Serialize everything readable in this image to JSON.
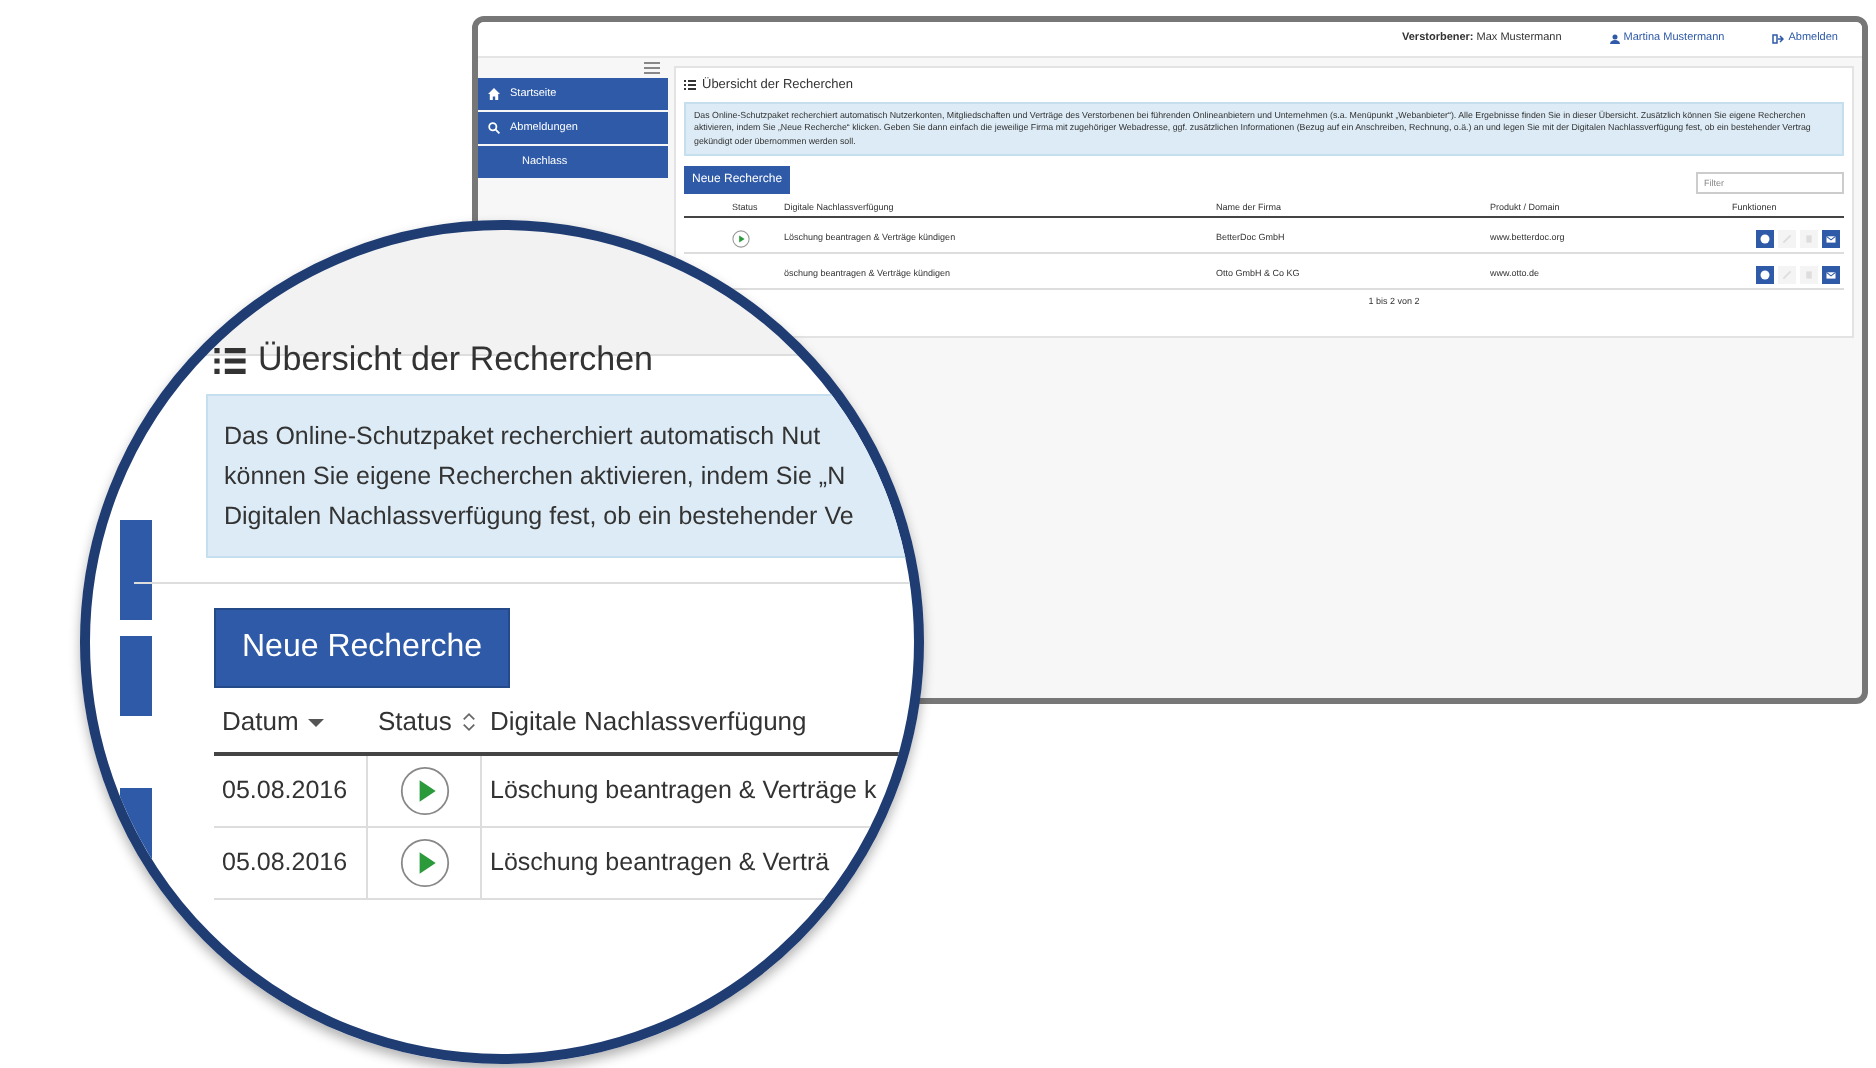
{
  "window": {
    "header": {
      "deceased_label": "Verstorbener:",
      "deceased_name": "Max Mustermann",
      "user": "Martina Mustermann",
      "logout": "Abmelden"
    },
    "sidebar": {
      "items": [
        {
          "label": "Startseite"
        },
        {
          "label": "Abmeldungen"
        },
        {
          "label": "Nachlass"
        }
      ]
    },
    "panel": {
      "title": "Übersicht der Recherchen",
      "info": "Das Online-Schutzpaket recherchiert automatisch Nutzerkonten, Mitgliedschaften und Verträge des Verstorbenen bei führenden Onlineanbietern und Unternehmen (s.a. Menüpunkt „Webanbieter“). Alle Ergebnisse finden Sie in dieser Übersicht. Zusätzlich können Sie eigene Recherchen aktivieren, indem Sie „Neue Recherche“ klicken. Geben Sie dann einfach die jeweilige Firma mit zugehöriger Webadresse, ggf. zusätzlichen Informationen (Bezug auf ein Anschreiben, Rechnung, o.ä.) an und legen Sie mit der Digitalen Nachlassverfügung fest, ob ein bestehender Vertrag gekündigt oder übernommen werden soll.",
      "new_button": "Neue Recherche",
      "filter_placeholder": "Filter",
      "table": {
        "columns": [
          "Status",
          "Digitale Nachlassverfügung",
          "Name der Firma",
          "Produkt / Domain",
          "Funktionen"
        ],
        "rows": [
          {
            "kind": "play",
            "task": "Löschung beantragen & Verträge kündigen",
            "company": "BetterDoc GmbH",
            "domain": "www.betterdoc.org"
          },
          {
            "kind": "plain",
            "task": "öschung beantragen & Verträge kündigen",
            "company": "Otto GmbH & Co KG",
            "domain": "www.otto.de"
          }
        ],
        "footer": "1 bis 2 von 2"
      }
    }
  },
  "magnifier": {
    "title": "Übersicht der Recherchen",
    "info_lines": [
      "Das Online-Schutzpaket recherchiert automatisch Nut",
      "können Sie eigene Recherchen aktivieren, indem Sie „N",
      "Digitalen Nachlassverfügung fest, ob ein bestehender Ve"
    ],
    "new_button": "Neue Recherche",
    "columns": [
      "Datum",
      "Status",
      "Digitale Nachlassverfügung"
    ],
    "rows": [
      {
        "date": "05.08.2016",
        "task": "Löschung beantragen & Verträge k"
      },
      {
        "date": "05.08.2016",
        "task": "Löschung beantragen & Verträ"
      }
    ]
  }
}
